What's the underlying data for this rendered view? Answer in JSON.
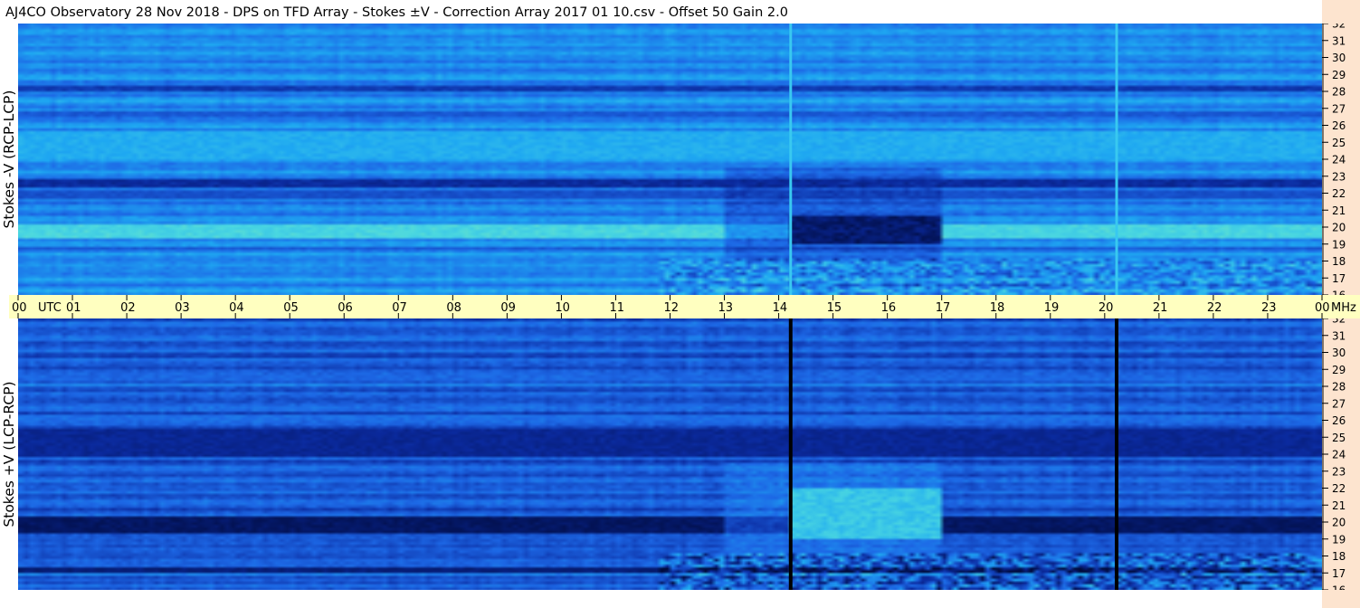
{
  "chart_data": {
    "type": "heatmap",
    "title": "AJ4CO Observatory  28 Nov 2018  -  DPS on TFD Array  -  Stokes ±V  -  Correction Array 2017 01 10.csv  -  Offset 50  Gain 2.0",
    "xlabel": "UTC",
    "ylabel_unit": "MHz",
    "x_ticks": [
      "00",
      "01",
      "02",
      "03",
      "04",
      "05",
      "06",
      "07",
      "08",
      "09",
      "10",
      "11",
      "12",
      "13",
      "14",
      "15",
      "16",
      "17",
      "18",
      "19",
      "20",
      "21",
      "22",
      "23",
      "00"
    ],
    "xlim_hours": [
      0,
      24
    ],
    "y_ticks": [
      16,
      17,
      18,
      19,
      20,
      21,
      22,
      23,
      24,
      25,
      26,
      27,
      28,
      29,
      30,
      31,
      32
    ],
    "ylim_mhz": [
      16,
      32
    ],
    "panels": [
      {
        "name": "top",
        "ylabel": "Stokes -V (RCP-LCP)",
        "colormap": [
          "#000a3a",
          "#0b2a9e",
          "#1d68e6",
          "#1ea8f2",
          "#4cd9e0",
          "#c8f06a"
        ],
        "base_level": 0.5,
        "bright_bands_mhz": [
          [
            19.4,
            20.1,
            0.78
          ],
          [
            24.0,
            25.6,
            0.62
          ],
          [
            22.4,
            22.8,
            0.2
          ],
          [
            28.0,
            28.4,
            0.25
          ]
        ],
        "dark_bands_mhz": [
          [
            21.6,
            22.2,
            0.32
          ],
          [
            26.5,
            26.8,
            0.35
          ],
          [
            18.6,
            18.9,
            0.35
          ]
        ],
        "vertical_lines_utc": [
          14.22,
          20.22
        ],
        "event": {
          "t_start": 13.0,
          "t_end": 17.0,
          "f_low": 18.0,
          "f_high": 23.5,
          "strong_t_start": 14.25,
          "strong_f_low": 19.0,
          "strong_f_high": 20.6,
          "level": 0.1
        }
      },
      {
        "name": "bottom",
        "ylabel": "Stokes +V (LCP-RCP)",
        "colormap": [
          "#000a3a",
          "#0b2a9e",
          "#1d68e6",
          "#1ea8f2",
          "#4cd9e0",
          "#c8f06a"
        ],
        "base_level": 0.36,
        "bright_bands_mhz": [
          [
            26.0,
            26.3,
            0.42
          ],
          [
            28.3,
            28.6,
            0.4
          ]
        ],
        "dark_bands_mhz": [
          [
            19.4,
            20.4,
            0.08
          ],
          [
            23.8,
            25.5,
            0.18
          ],
          [
            17.0,
            17.3,
            0.12
          ]
        ],
        "vertical_lines_utc": [
          14.22,
          20.22
        ],
        "event": {
          "t_start": 13.0,
          "t_end": 17.0,
          "f_low": 18.0,
          "f_high": 23.5,
          "strong_t_start": 14.25,
          "strong_f_low": 19.0,
          "strong_f_high": 22.0,
          "level": 0.72
        }
      }
    ],
    "legend": "none",
    "grid": false
  }
}
